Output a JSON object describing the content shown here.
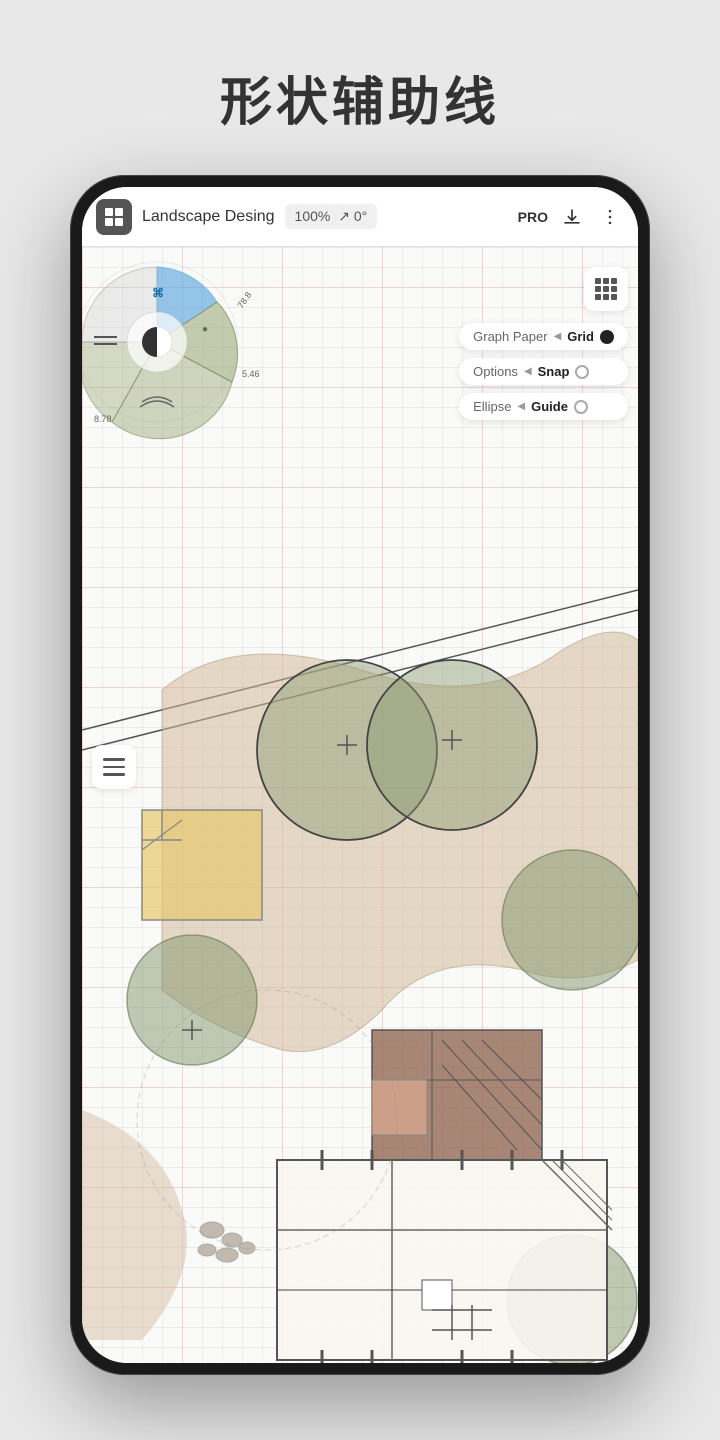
{
  "page": {
    "title": "形状辅助线"
  },
  "topbar": {
    "project_name": "Landscape Desing",
    "zoom": "100%",
    "rotation": "↗ 0°",
    "pro_label": "PRO",
    "grid_icon": "grid-icon",
    "download_icon": "download-icon",
    "more_icon": "more-icon"
  },
  "options_panel": {
    "row1": {
      "left": "Graph Paper",
      "right": "Grid",
      "indicator": "filled"
    },
    "row2": {
      "left": "Options",
      "right": "Snap",
      "indicator": "empty"
    },
    "row3": {
      "left": "Ellipse",
      "right": "Guide",
      "indicator": "empty"
    }
  },
  "canvas": {
    "background": "#fafaf8"
  }
}
